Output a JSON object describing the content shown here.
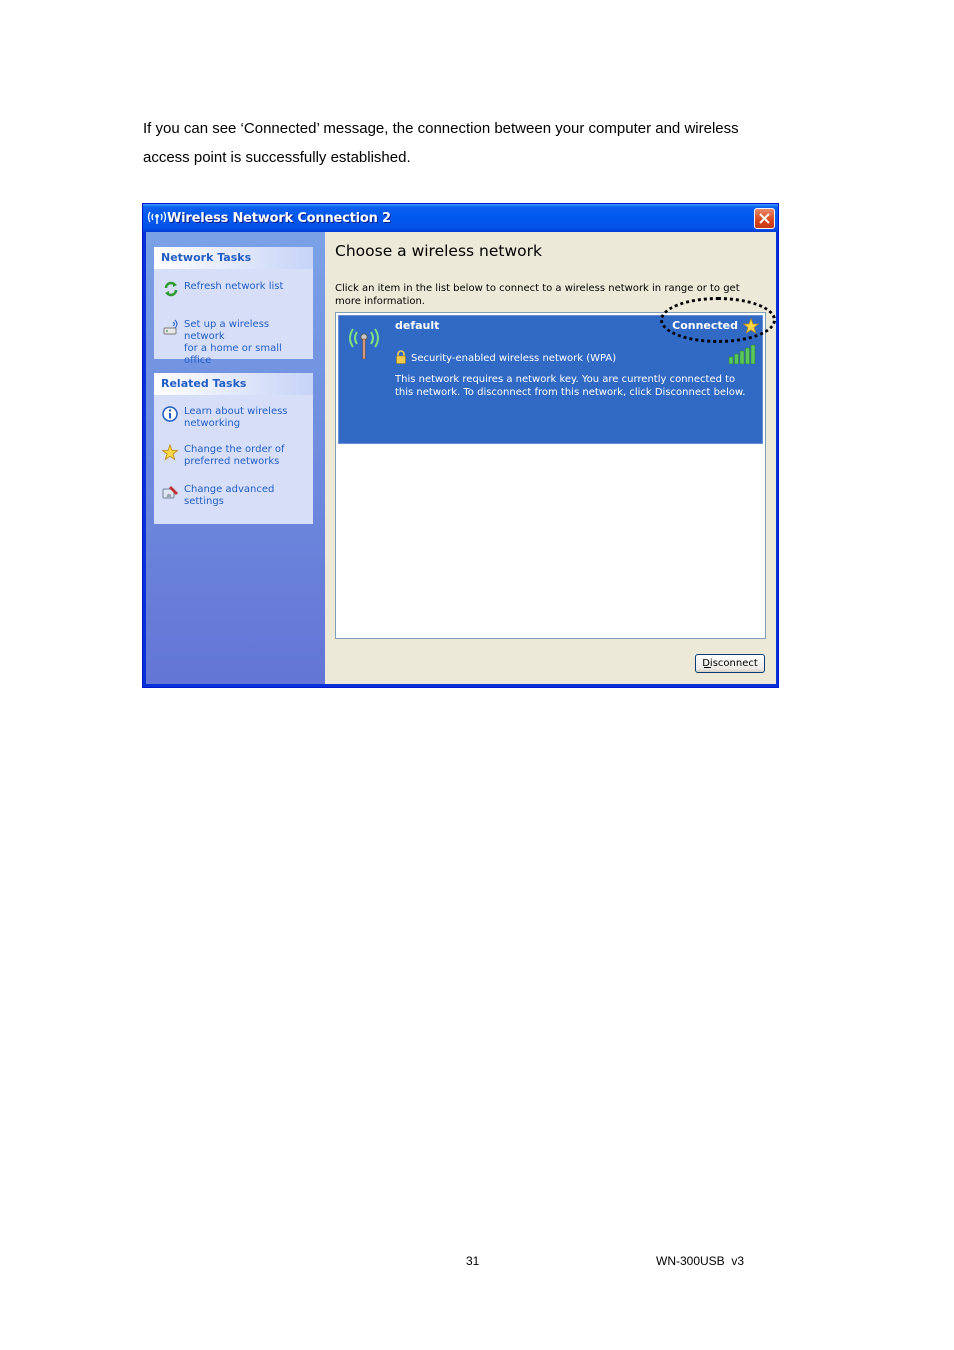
{
  "intro": {
    "line1": "If you can see ‘Connected’ message, the connection between your computer and wireless",
    "line2": "access point is successfully established."
  },
  "window": {
    "title": "Wireless Network Connection 2",
    "close_icon": "close-x-icon",
    "sidebar": {
      "network_tasks": {
        "header": "Network Tasks",
        "items": [
          {
            "icon": "refresh-icon",
            "label": "Refresh network list",
            "label2": ""
          },
          {
            "icon": "wireless-setup-icon",
            "label": "Set up a wireless network",
            "label2": "for a home or small office"
          }
        ]
      },
      "related_tasks": {
        "header": "Related Tasks",
        "items": [
          {
            "icon": "info-icon",
            "label": "Learn about wireless",
            "label2": "networking"
          },
          {
            "icon": "star-icon",
            "label": "Change the order of",
            "label2": "preferred networks"
          },
          {
            "icon": "settings-icon",
            "label": "Change advanced",
            "label2": "settings"
          }
        ]
      }
    },
    "main": {
      "heading": "Choose a wireless network",
      "instruction": "Click an item in the list below to connect to a wireless network in range or to get more information.",
      "network": {
        "name": "default",
        "status": "Connected",
        "security": "Security-enabled wireless network (WPA)",
        "description": "This network requires a network key. You are currently connected to this network. To disconnect from this network, click Disconnect below.",
        "signal_bars": 5
      },
      "disconnect_label": "Disconnect"
    }
  },
  "footer": {
    "page_number": "31",
    "model": "WN-300USB  v3"
  }
}
